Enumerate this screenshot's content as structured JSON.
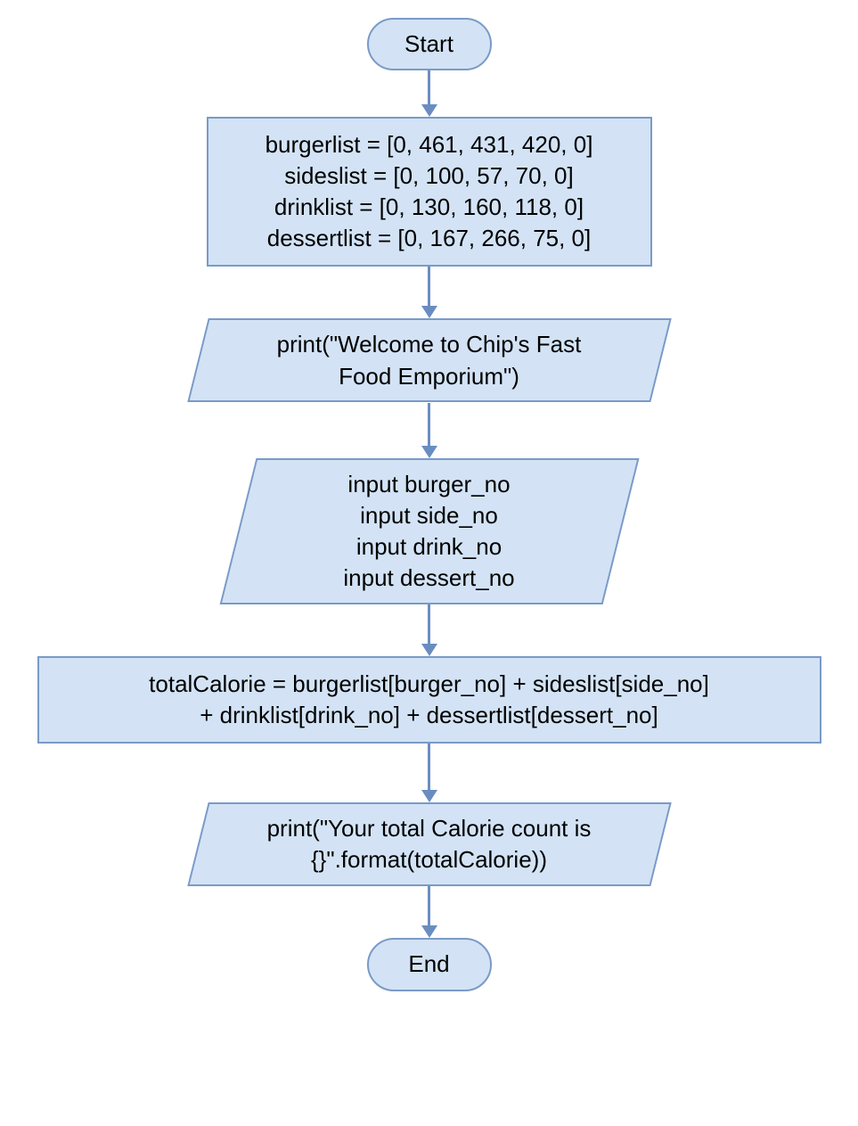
{
  "chart_data": {
    "type": "flowchart",
    "nodes": [
      {
        "id": "start",
        "shape": "terminal",
        "text": "Start"
      },
      {
        "id": "init",
        "shape": "process",
        "lines": [
          "burgerlist = [0, 461, 431, 420, 0]",
          "sideslist = [0, 100, 57, 70, 0]",
          "drinklist = [0, 130, 160, 118, 0]",
          "dessertlist = [0, 167, 266, 75, 0]"
        ]
      },
      {
        "id": "welcome",
        "shape": "io",
        "lines": [
          "print(\"Welcome to Chip's Fast",
          "Food Emporium\")"
        ]
      },
      {
        "id": "inputs",
        "shape": "io",
        "lines": [
          "input burger_no",
          "input side_no",
          "input drink_no",
          "input dessert_no"
        ]
      },
      {
        "id": "calc",
        "shape": "process_wide",
        "lines": [
          "totalCalorie = burgerlist[burger_no] + sideslist[side_no]",
          "+ drinklist[drink_no] + dessertlist[dessert_no]"
        ]
      },
      {
        "id": "output",
        "shape": "io",
        "lines": [
          "print(\"Your total Calorie count is",
          "{}\".format(totalCalorie))"
        ]
      },
      {
        "id": "end",
        "shape": "terminal",
        "text": "End"
      }
    ],
    "edges": [
      {
        "from": "start",
        "to": "init"
      },
      {
        "from": "init",
        "to": "welcome"
      },
      {
        "from": "welcome",
        "to": "inputs"
      },
      {
        "from": "inputs",
        "to": "calc"
      },
      {
        "from": "calc",
        "to": "output"
      },
      {
        "from": "output",
        "to": "end"
      }
    ]
  }
}
